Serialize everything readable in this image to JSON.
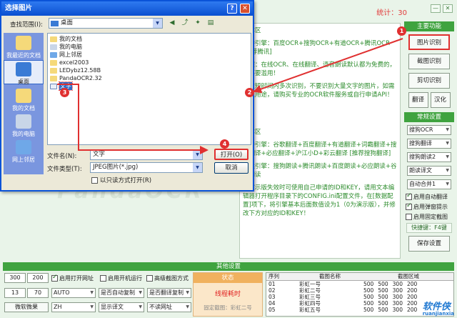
{
  "app": {
    "stats": "统计：30",
    "watermark": "PandaOCR",
    "text_panel": {
      "p1": "文本区",
      "p2": "支持引擎：百度OCR+搜狗OCR+有道OCR+腾讯OCR [推荐腾讯]",
      "p3": "提醒：在线OCR、在线翻译、语音朗读默认都为免费的，请不要滥用！",
      "p4": "要在短时间内多次识别，不要识别大量文字的图片，如需商业用途，请购买专业的OCR软件服务或自行申请API！",
      "p5": "文本区",
      "p6": "支持引擎：谷歌翻译+百度翻译+有道翻译+词霸翻译+搜狗翻译+必应翻译+沪江小D+彩云翻译 [推荐搜狗翻译]",
      "p7": "朗读引擎：搜狗朗读+腾讯朗读+百度朗读+必应朗读+谷歌朗读",
      "p8": "当演示版失效时可使用自己申请的ID和KEY，请用文本编辑器打开程序目录下的CONFIG.ini配置文件，在[数据配置]项下，将引擎基本后面数值设为1（0为演示版），并修改下方对应的ID和KEY！"
    },
    "right_panel": {
      "header_main": "主要功能",
      "btn_image_ocr": "图片识别",
      "btn_screenshot_ocr": "截图识别",
      "btn_clipboard_ocr": "剪切识别",
      "btn_translate": "翻译",
      "btn_hanhua": "汉化",
      "header_common": "常规设置",
      "sel_ocr": "搜狗OCR",
      "sel_translate": "搜狗翻译",
      "sel_tts": "搜狗朗读2",
      "sel_lang": "朗读译文",
      "sel_auto": "自动合并1",
      "chk_auto_translate": "启用自动翻译",
      "chk_popup": "启用弹窗提示",
      "chk_fixed_shot": "启用固定截图",
      "hotkey": "快捷键：F4键",
      "btn_save": "保存设置"
    },
    "bottom": {
      "header": "其他设置",
      "w": "300",
      "h": "200",
      "x": "13",
      "y": "70",
      "chk_open_url": "启用打开网址",
      "chk_startup": "启用开机运行",
      "chk_hd_shot": "高级截图方式",
      "sel_auto": "AUTO",
      "sel_autocopy": "是否自动复制",
      "sel_copyoutput": "是否翻译复制",
      "btn_wechat": "微软微果",
      "sel_zh": "ZH",
      "sel_showtranslate": "显示译文",
      "sel_noopen": "不读网址",
      "status_title": "状态",
      "status_text": "线程耗时",
      "status_sub": "固定截图：彩虹二号",
      "table_headers": [
        "序列",
        "截图名称",
        "截图区域"
      ],
      "rows": [
        [
          "01",
          "彩虹一号",
          "500",
          "500",
          "300",
          "200"
        ],
        [
          "02",
          "彩虹二号",
          "500",
          "500",
          "300",
          "200"
        ],
        [
          "03",
          "彩虹三号",
          "500",
          "500",
          "300",
          "200"
        ],
        [
          "04",
          "彩虹四号",
          "500",
          "500",
          "300",
          "200"
        ],
        [
          "05",
          "彩虹五号",
          "500",
          "500",
          "300",
          "200"
        ]
      ]
    },
    "logo": "软件侠",
    "logo_sub": "ruanjianxia"
  },
  "dialog": {
    "title": "选择图片",
    "look_in_label": "查找范围(I):",
    "look_in_value": "桌面",
    "places": [
      "我最近的文档",
      "桌面",
      "我的文档",
      "我的电脑",
      "网上邻居"
    ],
    "files": [
      "我的文档",
      "我的电脑",
      "网上邻居",
      "excel2003",
      "LEDybz12.58B",
      "PandaOCR2.32",
      "文字"
    ],
    "filename_label": "文件名(N):",
    "filename_value": "文字",
    "filetype_label": "文件类型(T):",
    "filetype_value": "JPEG图片(*.jpg)",
    "readonly_label": "以只读方式打开(R)",
    "open_btn": "打开(O)",
    "cancel_btn": "取消"
  },
  "callouts": [
    "1",
    "2",
    "3",
    "4"
  ],
  "colors": {
    "accent_green": "#3fa33f",
    "callout_red": "#e03030",
    "xp_blue": "#0a53d8"
  }
}
